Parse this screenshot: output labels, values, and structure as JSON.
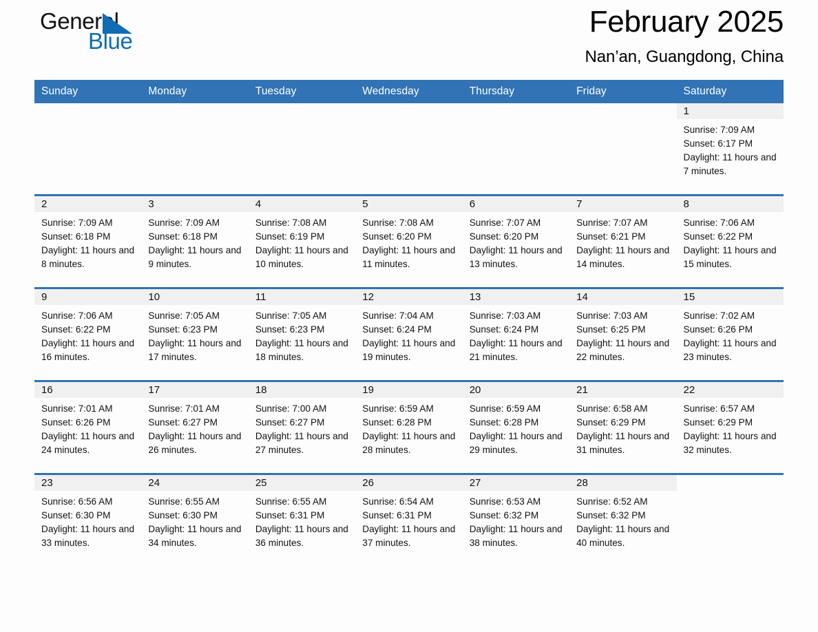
{
  "brand": {
    "name_part1": "General",
    "name_part2": "Blue",
    "flag_color": "#0f6cb5"
  },
  "header": {
    "title": "February 2025",
    "subtitle": "Nan’an, Guangdong, China",
    "header_bg": "#3173b4",
    "daynum_bg": "#f0f0f0"
  },
  "weekdays": [
    "Sunday",
    "Monday",
    "Tuesday",
    "Wednesday",
    "Thursday",
    "Friday",
    "Saturday"
  ],
  "weeks": [
    [
      {
        "day": "",
        "blank": true
      },
      {
        "day": "",
        "blank": true
      },
      {
        "day": "",
        "blank": true
      },
      {
        "day": "",
        "blank": true
      },
      {
        "day": "",
        "blank": true
      },
      {
        "day": "",
        "blank": true
      },
      {
        "day": "1",
        "sunrise": "Sunrise: 7:09 AM",
        "sunset": "Sunset: 6:17 PM",
        "daylight": "Daylight: 11 hours and 7 minutes."
      }
    ],
    [
      {
        "day": "2",
        "sunrise": "Sunrise: 7:09 AM",
        "sunset": "Sunset: 6:18 PM",
        "daylight": "Daylight: 11 hours and 8 minutes."
      },
      {
        "day": "3",
        "sunrise": "Sunrise: 7:09 AM",
        "sunset": "Sunset: 6:18 PM",
        "daylight": "Daylight: 11 hours and 9 minutes."
      },
      {
        "day": "4",
        "sunrise": "Sunrise: 7:08 AM",
        "sunset": "Sunset: 6:19 PM",
        "daylight": "Daylight: 11 hours and 10 minutes."
      },
      {
        "day": "5",
        "sunrise": "Sunrise: 7:08 AM",
        "sunset": "Sunset: 6:20 PM",
        "daylight": "Daylight: 11 hours and 11 minutes."
      },
      {
        "day": "6",
        "sunrise": "Sunrise: 7:07 AM",
        "sunset": "Sunset: 6:20 PM",
        "daylight": "Daylight: 11 hours and 13 minutes."
      },
      {
        "day": "7",
        "sunrise": "Sunrise: 7:07 AM",
        "sunset": "Sunset: 6:21 PM",
        "daylight": "Daylight: 11 hours and 14 minutes."
      },
      {
        "day": "8",
        "sunrise": "Sunrise: 7:06 AM",
        "sunset": "Sunset: 6:22 PM",
        "daylight": "Daylight: 11 hours and 15 minutes."
      }
    ],
    [
      {
        "day": "9",
        "sunrise": "Sunrise: 7:06 AM",
        "sunset": "Sunset: 6:22 PM",
        "daylight": "Daylight: 11 hours and 16 minutes."
      },
      {
        "day": "10",
        "sunrise": "Sunrise: 7:05 AM",
        "sunset": "Sunset: 6:23 PM",
        "daylight": "Daylight: 11 hours and 17 minutes."
      },
      {
        "day": "11",
        "sunrise": "Sunrise: 7:05 AM",
        "sunset": "Sunset: 6:23 PM",
        "daylight": "Daylight: 11 hours and 18 minutes."
      },
      {
        "day": "12",
        "sunrise": "Sunrise: 7:04 AM",
        "sunset": "Sunset: 6:24 PM",
        "daylight": "Daylight: 11 hours and 19 minutes."
      },
      {
        "day": "13",
        "sunrise": "Sunrise: 7:03 AM",
        "sunset": "Sunset: 6:24 PM",
        "daylight": "Daylight: 11 hours and 21 minutes."
      },
      {
        "day": "14",
        "sunrise": "Sunrise: 7:03 AM",
        "sunset": "Sunset: 6:25 PM",
        "daylight": "Daylight: 11 hours and 22 minutes."
      },
      {
        "day": "15",
        "sunrise": "Sunrise: 7:02 AM",
        "sunset": "Sunset: 6:26 PM",
        "daylight": "Daylight: 11 hours and 23 minutes."
      }
    ],
    [
      {
        "day": "16",
        "sunrise": "Sunrise: 7:01 AM",
        "sunset": "Sunset: 6:26 PM",
        "daylight": "Daylight: 11 hours and 24 minutes."
      },
      {
        "day": "17",
        "sunrise": "Sunrise: 7:01 AM",
        "sunset": "Sunset: 6:27 PM",
        "daylight": "Daylight: 11 hours and 26 minutes."
      },
      {
        "day": "18",
        "sunrise": "Sunrise: 7:00 AM",
        "sunset": "Sunset: 6:27 PM",
        "daylight": "Daylight: 11 hours and 27 minutes."
      },
      {
        "day": "19",
        "sunrise": "Sunrise: 6:59 AM",
        "sunset": "Sunset: 6:28 PM",
        "daylight": "Daylight: 11 hours and 28 minutes."
      },
      {
        "day": "20",
        "sunrise": "Sunrise: 6:59 AM",
        "sunset": "Sunset: 6:28 PM",
        "daylight": "Daylight: 11 hours and 29 minutes."
      },
      {
        "day": "21",
        "sunrise": "Sunrise: 6:58 AM",
        "sunset": "Sunset: 6:29 PM",
        "daylight": "Daylight: 11 hours and 31 minutes."
      },
      {
        "day": "22",
        "sunrise": "Sunrise: 6:57 AM",
        "sunset": "Sunset: 6:29 PM",
        "daylight": "Daylight: 11 hours and 32 minutes."
      }
    ],
    [
      {
        "day": "23",
        "sunrise": "Sunrise: 6:56 AM",
        "sunset": "Sunset: 6:30 PM",
        "daylight": "Daylight: 11 hours and 33 minutes."
      },
      {
        "day": "24",
        "sunrise": "Sunrise: 6:55 AM",
        "sunset": "Sunset: 6:30 PM",
        "daylight": "Daylight: 11 hours and 34 minutes."
      },
      {
        "day": "25",
        "sunrise": "Sunrise: 6:55 AM",
        "sunset": "Sunset: 6:31 PM",
        "daylight": "Daylight: 11 hours and 36 minutes."
      },
      {
        "day": "26",
        "sunrise": "Sunrise: 6:54 AM",
        "sunset": "Sunset: 6:31 PM",
        "daylight": "Daylight: 11 hours and 37 minutes."
      },
      {
        "day": "27",
        "sunrise": "Sunrise: 6:53 AM",
        "sunset": "Sunset: 6:32 PM",
        "daylight": "Daylight: 11 hours and 38 minutes."
      },
      {
        "day": "28",
        "sunrise": "Sunrise: 6:52 AM",
        "sunset": "Sunset: 6:32 PM",
        "daylight": "Daylight: 11 hours and 40 minutes."
      },
      {
        "day": "",
        "blank": true
      }
    ]
  ]
}
